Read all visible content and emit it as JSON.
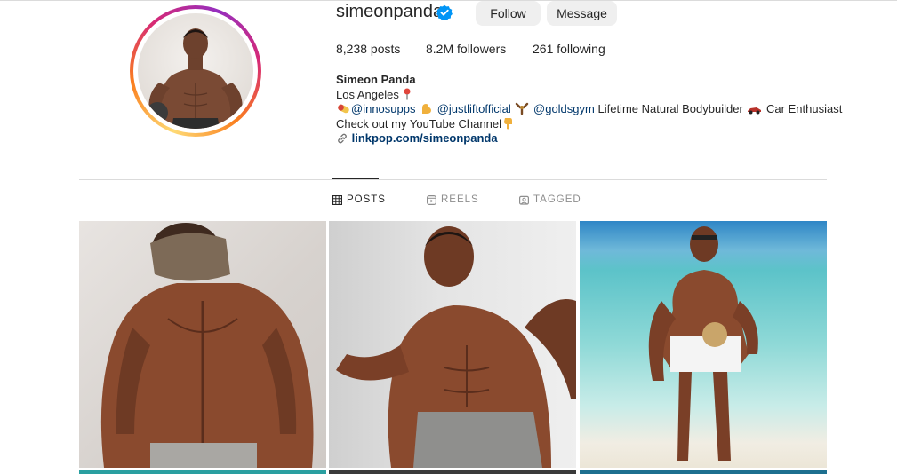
{
  "profile": {
    "username": "simeonpanda",
    "verified": true,
    "follow_label": "Follow",
    "message_label": "Message",
    "stats": {
      "posts": "8,238 posts",
      "followers": "8.2M followers",
      "following": "261 following"
    },
    "bio": {
      "name": "Simeon Panda",
      "location": "Los Angeles",
      "mention1": "@innosupps",
      "mention2": "@justliftofficial",
      "mention3": "@goldsgym",
      "line3_text": "Lifetime Natural Bodybuilder",
      "line3_tail": "Car Enthusiast",
      "line4": "Check out my YouTube Channel",
      "link": "linkpop.com/simeonpanda"
    }
  },
  "tabs": [
    {
      "label": "POSTS",
      "icon": "grid-icon",
      "active": true
    },
    {
      "label": "REELS",
      "icon": "reels-icon",
      "active": false
    },
    {
      "label": "TAGGED",
      "icon": "tagged-icon",
      "active": false
    }
  ],
  "posts": [
    {
      "icon": "photo-back-pose"
    },
    {
      "icon": "photo-front-pose"
    },
    {
      "icon": "photo-beach"
    }
  ],
  "colors": {
    "text": "#262626",
    "muted": "#8e8e8e",
    "link": "#00376b",
    "verified": "#0095f6",
    "button_bg": "#efefef",
    "divider": "#dbdbdb"
  }
}
